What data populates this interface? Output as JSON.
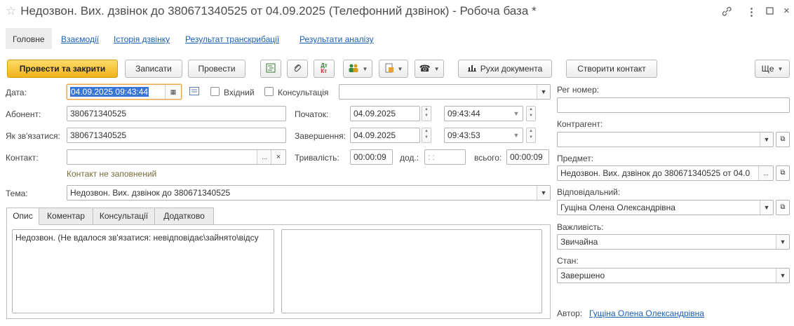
{
  "window": {
    "title": "Недозвон. Вих. дзвінок до  380671340525 от 04.09.2025 (Телефонний дзвінок) - Робоча база *",
    "star_icon": "star-outline-icon",
    "controls": [
      "link-icon",
      "more-icon",
      "maximize-icon",
      "close-icon"
    ]
  },
  "nav": {
    "main": "Головне",
    "items": [
      "Взаємодії",
      "Історія дзвінку",
      "Результат транскрибації",
      "Результати аналізу"
    ]
  },
  "toolbar": {
    "post_close": "Провести та закрити",
    "save": "Записати",
    "post": "Провести",
    "movements": "Рухи документа",
    "create_contact": "Створити контакт",
    "more": "Ще"
  },
  "form": {
    "date_label": "Дата:",
    "date_value": "04.09.2025 09:43:44",
    "incoming_label": "Вхідний",
    "consult_label": "Консультація",
    "consult_value": "",
    "subscriber_label": "Абонент:",
    "subscriber_value": "380671340525",
    "how_label": "Як зв'язатися:",
    "how_value": "380671340525",
    "contact_label": "Контакт:",
    "contact_value": "",
    "contact_hint": "Контакт не заповнений",
    "start_label": "Початок:",
    "start_date": "04.09.2025",
    "start_time": "09:43:44",
    "end_label": "Завершення:",
    "end_date": "04.09.2025",
    "end_time": "09:43:53",
    "duration_label": "Тривалість:",
    "duration_value": "00:00:09",
    "add_label": "дод.:",
    "add_value": " : : ",
    "total_label": "всього:",
    "total_value": "00:00:09",
    "topic_label": "Тема:",
    "topic_value": "Недозвон. Вих. дзвінок до  380671340525"
  },
  "tabs": [
    "Опис",
    "Коментар",
    "Консультації",
    "Додатково"
  ],
  "description_text": "Недозвон. (Не вдалося зв'язатися: невідповідає\\зайнято\\відсу",
  "right": {
    "reg_label": "Рег номер:",
    "reg_value": "",
    "counterparty_label": "Контрагент:",
    "counterparty_value": "",
    "subject_label": "Предмет:",
    "subject_value": "Недозвон. Вих. дзвінок до  380671340525 от 04.0",
    "responsible_label": "Відповідальний:",
    "responsible_value": "Гущіна Олена Олександрівна",
    "importance_label": "Важливість:",
    "importance_value": "Звичайна",
    "state_label": "Стан:",
    "state_value": "Завершено",
    "author_label": "Автор:",
    "author_value": "Гущіна Олена Олександрівна"
  },
  "colors": {
    "primary_button": "#f2b319",
    "link": "#1a5fb4",
    "selection": "#3875d7"
  }
}
